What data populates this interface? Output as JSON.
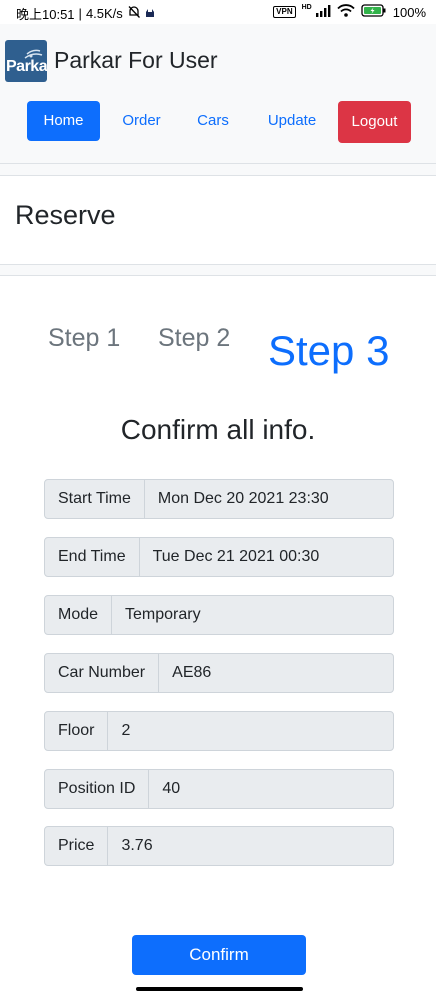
{
  "status_bar": {
    "time": "晚上10:51",
    "net_speed": "4.5K/s",
    "vpn": "VPN",
    "hd": "HD",
    "battery": "100%"
  },
  "nav": {
    "logo_text": "Parkar",
    "brand": "Parkar For User",
    "items": [
      {
        "label": "Home",
        "active": true
      },
      {
        "label": "Order"
      },
      {
        "label": "Cars"
      },
      {
        "label": "Update"
      }
    ],
    "logout": "Logout"
  },
  "header": {
    "title": "Reserve"
  },
  "steps": [
    "Step 1",
    "Step 2",
    "Step 3"
  ],
  "confirm": {
    "heading": "Confirm all info.",
    "rows": [
      {
        "label": "Start Time",
        "value": "Mon Dec 20 2021 23:30"
      },
      {
        "label": "End Time",
        "value": "Tue Dec 21 2021 00:30"
      },
      {
        "label": "Mode",
        "value": "Temporary"
      },
      {
        "label": "Car Number",
        "value": "AE86"
      },
      {
        "label": "Floor",
        "value": "2"
      },
      {
        "label": "Position ID",
        "value": "40"
      },
      {
        "label": "Price",
        "value": "3.76"
      }
    ],
    "button": "Confirm"
  },
  "colors": {
    "primary": "#0d6efd",
    "danger": "#dc3545",
    "muted": "#6c757d",
    "logo_bg": "#2f5f8f"
  }
}
